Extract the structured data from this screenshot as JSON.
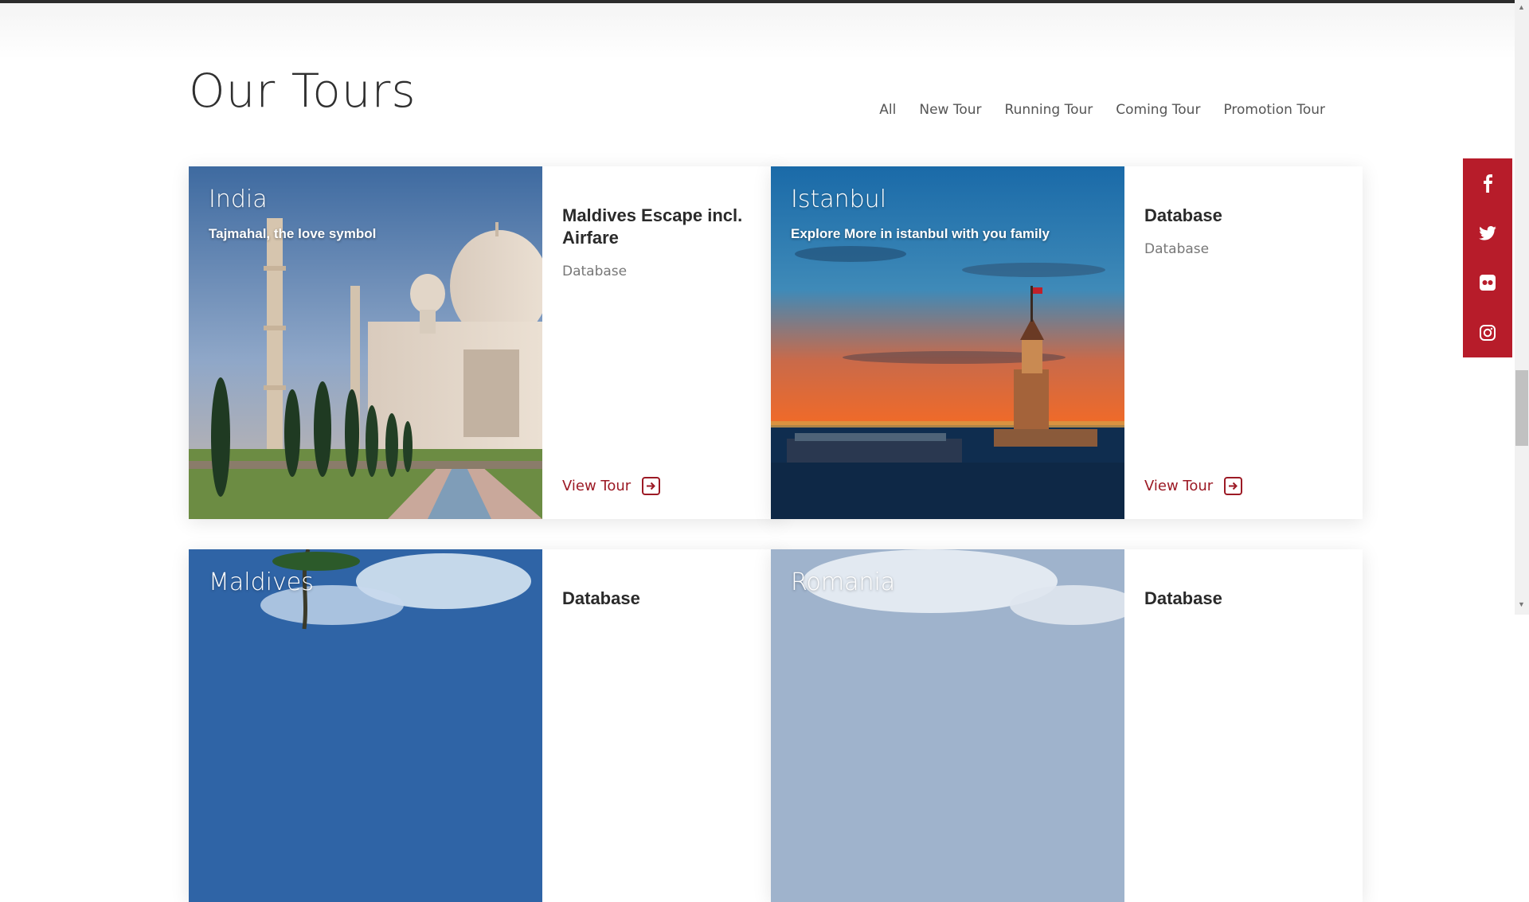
{
  "section": {
    "title": "Our Tours"
  },
  "filters": [
    "All",
    "New Tour",
    "Running Tour",
    "Coming Tour",
    "Promotion Tour"
  ],
  "tours": [
    {
      "place": "India",
      "tagline": "Tajmahal, the love symbol",
      "heading": "Maldives Escape incl. Airfare",
      "description": "Database",
      "cta": "View Tour"
    },
    {
      "place": "Istanbul",
      "tagline": "Explore More in istanbul with you family",
      "heading": "Database",
      "description": "Database",
      "cta": "View Tour"
    },
    {
      "place": "Maldives",
      "heading": "Database"
    },
    {
      "place": "Romania",
      "heading": "Database"
    }
  ],
  "social": [
    "facebook-icon",
    "twitter-icon",
    "flickr-icon",
    "instagram-icon"
  ],
  "colors": {
    "accent": "#9c1a25",
    "social_bg": "#b71c2a"
  }
}
